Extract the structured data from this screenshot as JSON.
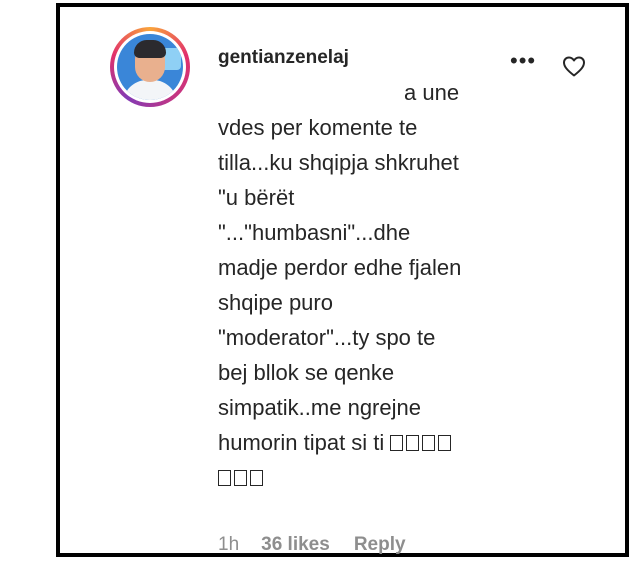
{
  "comment": {
    "username": "gentianzenelaj",
    "lines": [
      "a une",
      "vdes per komente te",
      "tilla...ku shqipja shkruhet",
      "\"u bërët",
      "\"...\"humbasni\"...dhe",
      "madje perdor edhe fjalen",
      "shqipe puro",
      "\"moderator\"...ty spo te",
      "bej bllok se qenke",
      "simpatik..me ngrejne",
      "humorin tipat si ti"
    ],
    "time": "1h",
    "likes": "36 likes",
    "reply_label": "Reply"
  },
  "icons": {
    "more": "more-options-icon",
    "like": "heart-icon",
    "emoji": "emoji-glyph-placeholder"
  },
  "colors": {
    "text": "#262626",
    "meta": "#8e8e8e",
    "frame": "#000000"
  }
}
